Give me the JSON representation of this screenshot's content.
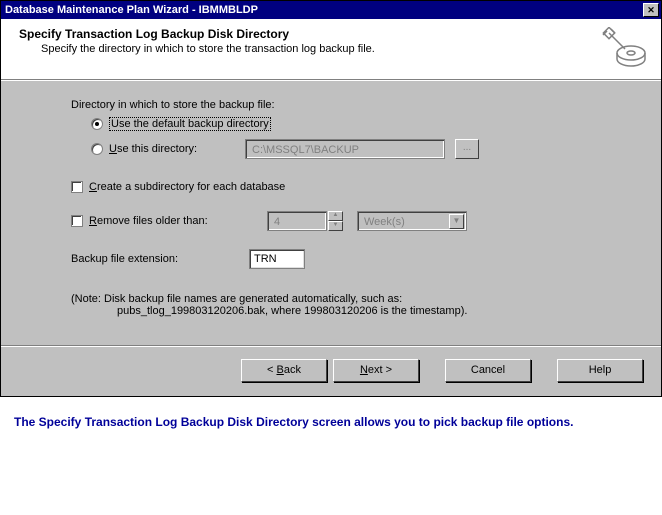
{
  "window": {
    "title": "Database Maintenance Plan Wizard - IBMMBLDP",
    "close_glyph": "✕"
  },
  "header": {
    "title": "Specify Transaction Log Backup Disk Directory",
    "subtitle": "Specify the directory in which to store the transaction log backup file."
  },
  "content": {
    "dir_label": "Directory in which to store the backup file:",
    "radio_default": "Use the default backup directory",
    "radio_custom_prefix": "U",
    "radio_custom_rest": "se this directory:",
    "path_value": "C:\\MSSQL7\\BACKUP",
    "browse_label": "...",
    "subdir_prefix": "C",
    "subdir_rest": "reate a subdirectory for each database",
    "remove_prefix": "R",
    "remove_rest": "emove files older than:",
    "remove_value": "4",
    "remove_unit": "Week(s)",
    "ext_label": "Backup file extension:",
    "ext_value": "TRN",
    "note_l1": "(Note: Disk backup file names are generated automatically, such as:",
    "note_l2": "pubs_tlog_199803120206.bak, where 199803120206 is the timestamp)."
  },
  "buttons": {
    "back": "< Back",
    "next": "Next >",
    "cancel": "Cancel",
    "help": "Help"
  },
  "caption": "The Specify Transaction Log Backup Disk Directory screen  allows you to pick backup file options."
}
